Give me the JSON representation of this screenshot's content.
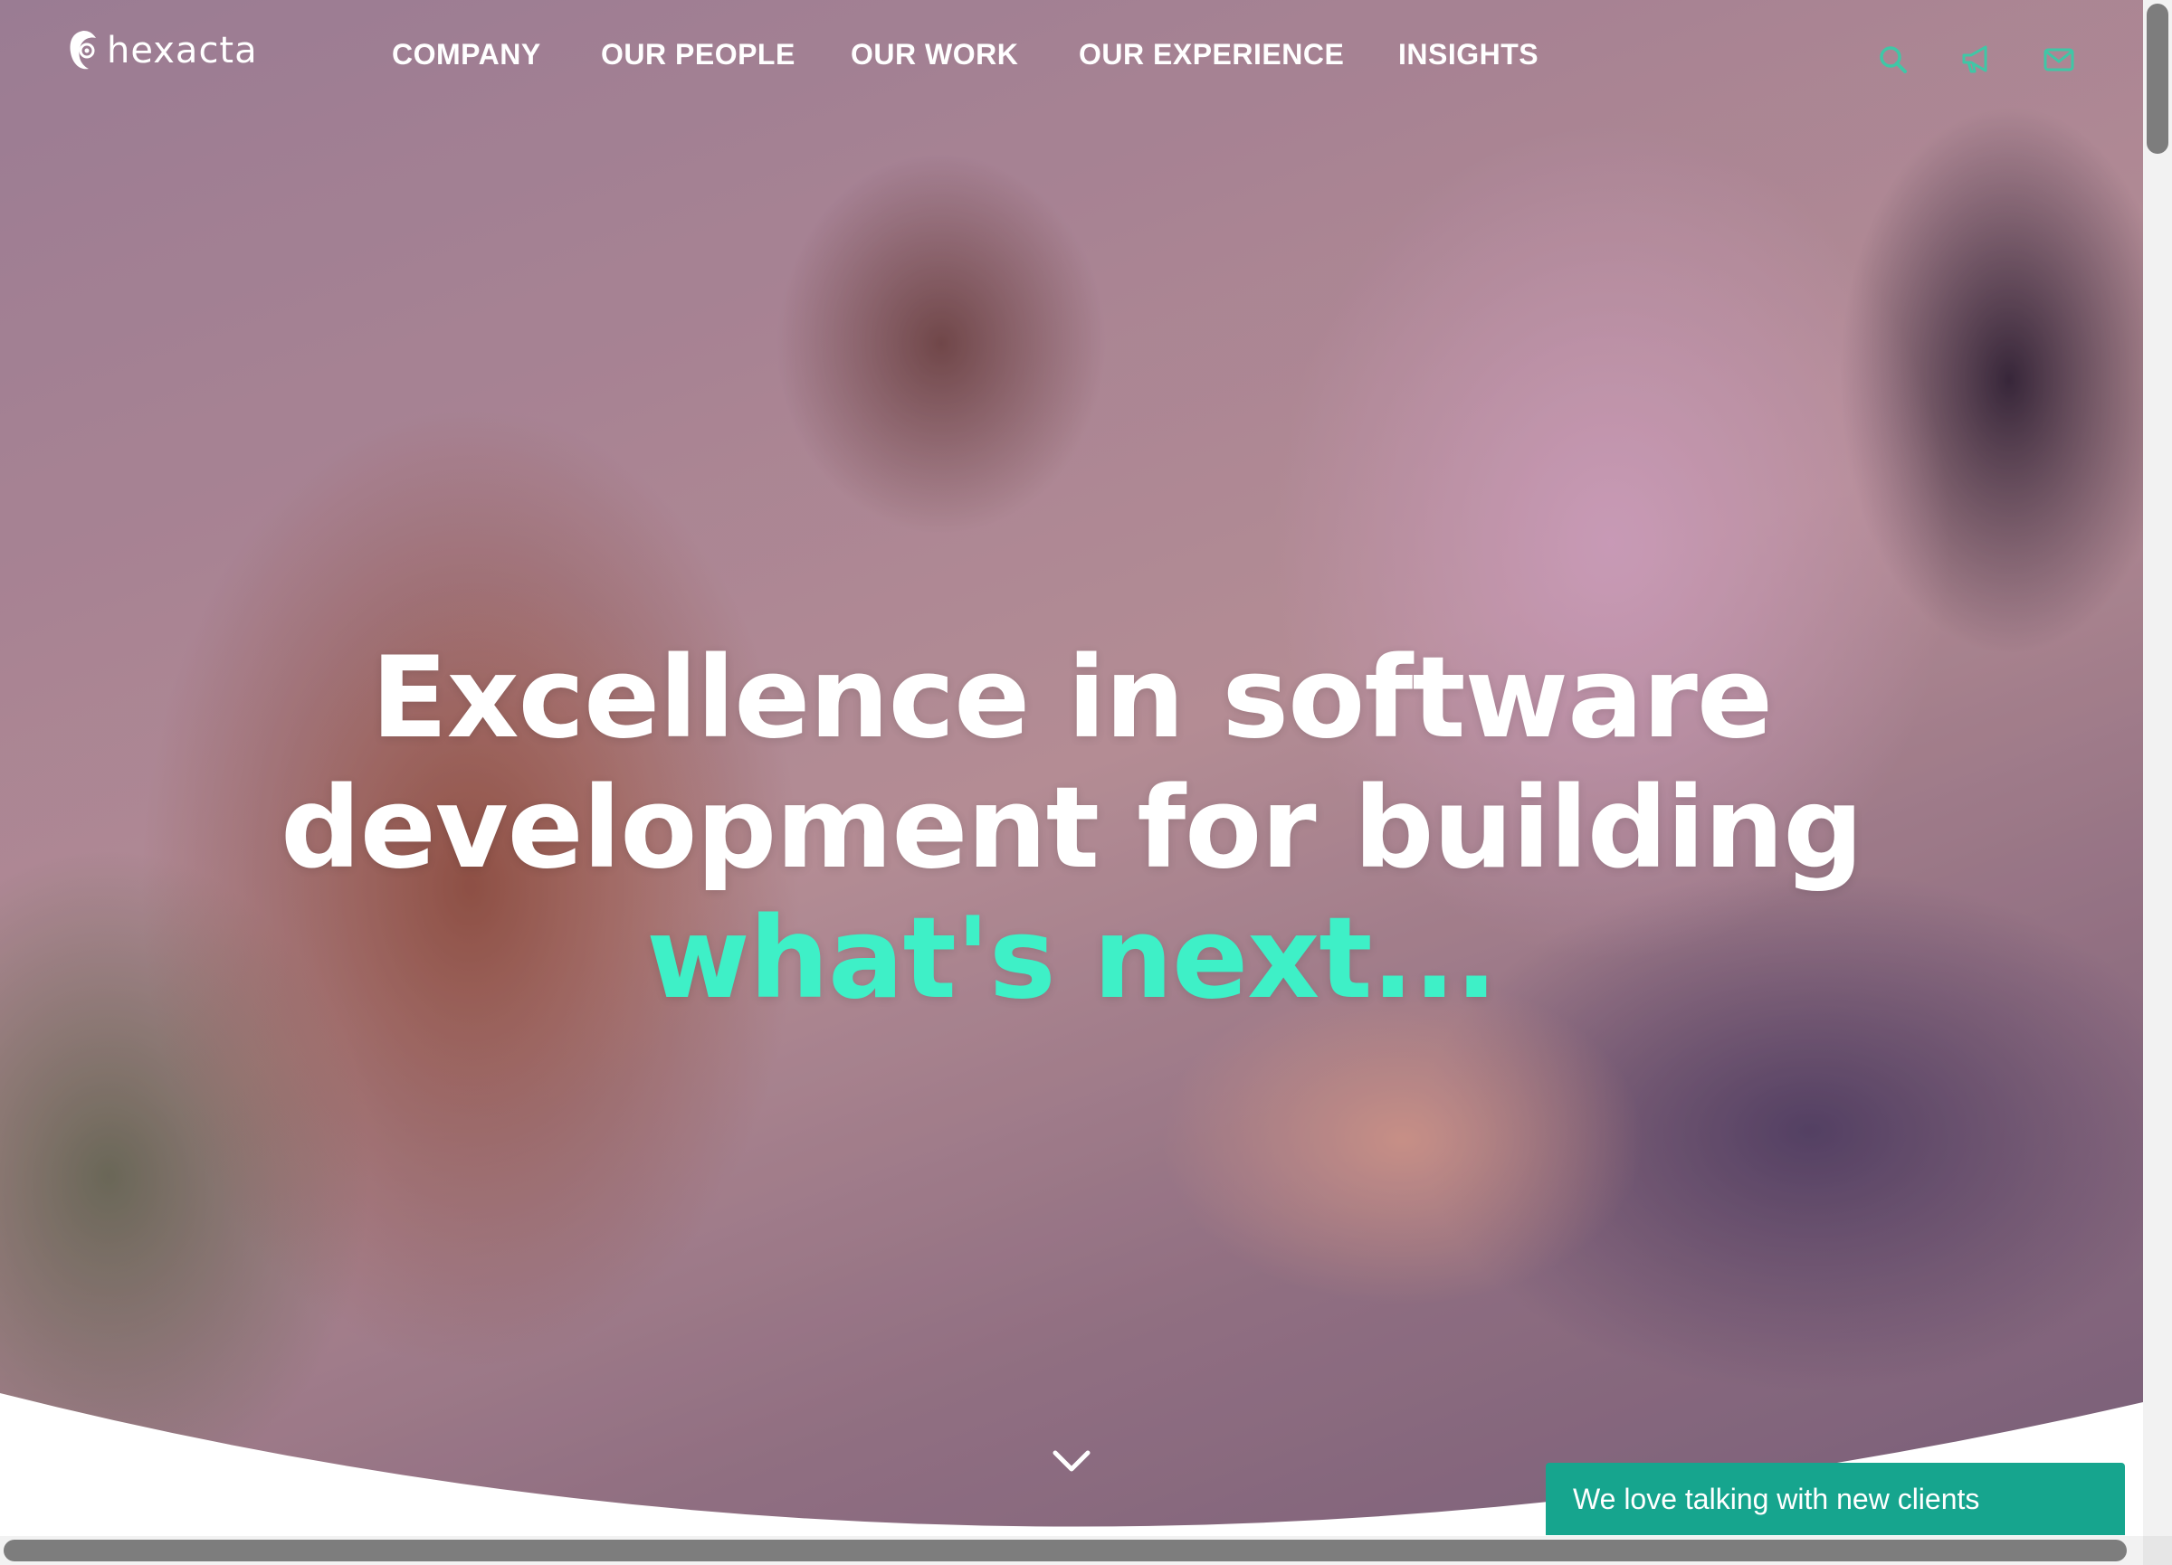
{
  "brand": {
    "logo_text": "hexacta",
    "logo_icon": "hexacta-logo-mark"
  },
  "nav": {
    "items": [
      {
        "label": "COMPANY"
      },
      {
        "label": "OUR PEOPLE"
      },
      {
        "label": "OUR WORK"
      },
      {
        "label": "OUR EXPERIENCE"
      },
      {
        "label": "INSIGHTS"
      }
    ]
  },
  "header_icons": [
    {
      "name": "search-icon"
    },
    {
      "name": "megaphone-icon"
    },
    {
      "name": "envelope-icon"
    }
  ],
  "hero": {
    "line1": "Excellence in software",
    "line2": "development for building",
    "line3": "what's next..."
  },
  "scroll_indicator": {
    "icon": "chevron-down-icon"
  },
  "chat": {
    "label": "We love talking with new clients"
  },
  "colors": {
    "accent": "#3ef0c7",
    "chat_bg": "#16a58e",
    "icon_teal": "#3fc7a6",
    "text_light": "#ffffff"
  }
}
